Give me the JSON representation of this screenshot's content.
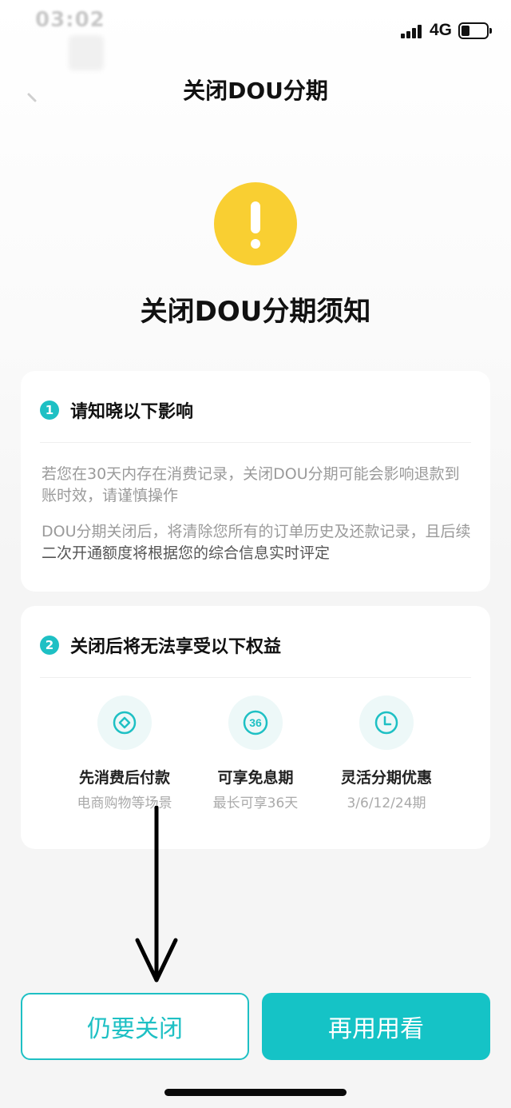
{
  "status_bar": {
    "time": "03:02",
    "network": "4G",
    "battery_level": 0.25
  },
  "nav": {
    "title": "关闭DOU分期",
    "back_icon": "back-arrow-icon"
  },
  "notice": {
    "icon": "warning-icon",
    "icon_color": "#f9cf32",
    "heading": "关闭DOU分期须知"
  },
  "section1": {
    "number": "1",
    "title": "请知晓以下影响",
    "para1": "若您在30天内存在消费记录，关闭DOU分期可能会影响退款到账时效，请谨慎操作",
    "para2_light": "DOU分期关闭后，将清除您所有的订单历史及还款记录，且后续",
    "para2_dark": "二次开通额度将根据您的综合信息实时评定"
  },
  "section2": {
    "number": "2",
    "title": "关闭后将无法享受以下权益",
    "benefits": [
      {
        "icon": "diamond-icon",
        "title": "先消费后付款",
        "subtitle": "电商购物等场景"
      },
      {
        "icon": "36-badge-icon",
        "icon_text": "36",
        "title": "可享免息期",
        "subtitle": "最长可享36天"
      },
      {
        "icon": "clock-icon",
        "title": "灵活分期优惠",
        "subtitle": "3/6/12/24期"
      }
    ]
  },
  "buttons": {
    "close_label": "仍要关闭",
    "keep_label": "再用用看"
  },
  "colors": {
    "accent": "#1ec0c4",
    "primary_button": "#15c3c6",
    "warning": "#f9cf32"
  }
}
